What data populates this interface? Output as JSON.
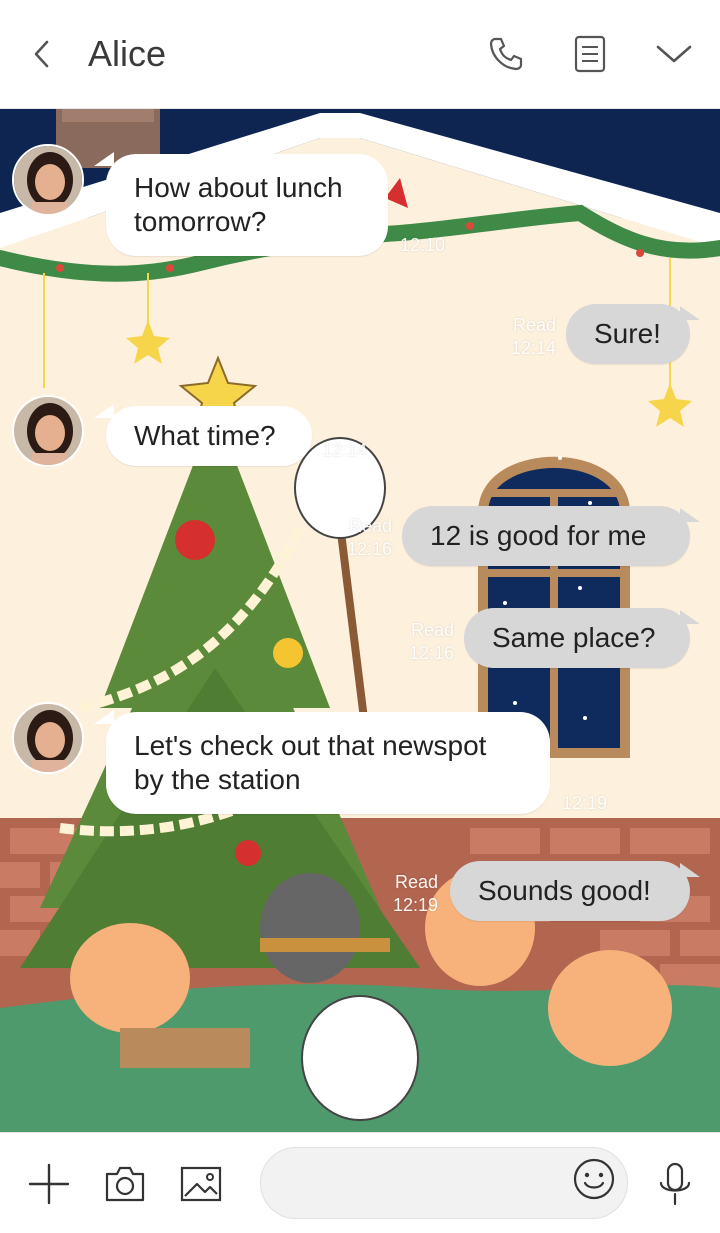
{
  "header": {
    "title": "Alice",
    "back_icon": "chevron-left-icon",
    "call_icon": "phone-icon",
    "notes_icon": "note-icon",
    "menu_icon": "chevron-down-icon"
  },
  "messages": [
    {
      "direction": "in",
      "lines": [
        "How about lunch",
        "tomorrow?"
      ],
      "time": "12:10",
      "read": ""
    },
    {
      "direction": "out",
      "lines": [
        "Sure!"
      ],
      "time": "12:14",
      "read": "Read"
    },
    {
      "direction": "in",
      "lines": [
        "What time?"
      ],
      "time": "12:14",
      "read": ""
    },
    {
      "direction": "out",
      "lines": [
        "12 is good for me"
      ],
      "time": "12:16",
      "read": "Read"
    },
    {
      "direction": "out",
      "lines": [
        "Same place?"
      ],
      "time": "12:16",
      "read": "Read"
    },
    {
      "direction": "in",
      "lines": [
        "Let's check out that newspot",
        "by the station"
      ],
      "time": "12:19",
      "read": ""
    },
    {
      "direction": "out",
      "lines": [
        "Sounds good!"
      ],
      "time": "12:19",
      "read": "Read"
    }
  ],
  "input": {
    "placeholder": "",
    "plus_icon": "plus-icon",
    "camera_icon": "camera-icon",
    "gallery_icon": "image-icon",
    "emoji_icon": "smiley-icon",
    "mic_icon": "microphone-icon"
  },
  "colors": {
    "incoming_bubble": "#ffffff",
    "outgoing_bubble": "#d7d7d7",
    "night_sky": "#0d2550",
    "wall": "#fdf0dd",
    "roof_snow": "#ffffff",
    "grass": "#4f9a6c"
  }
}
